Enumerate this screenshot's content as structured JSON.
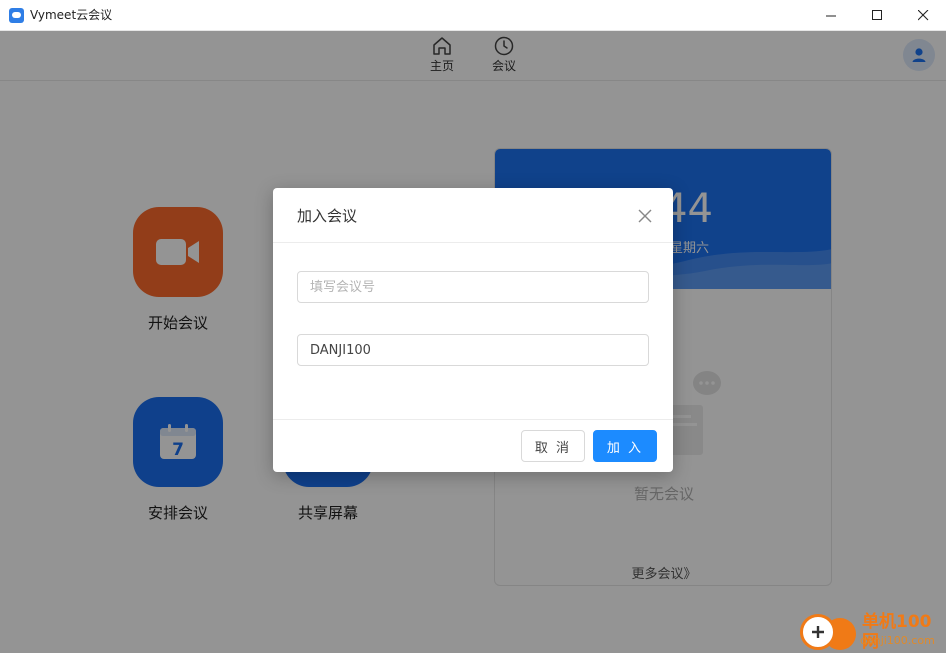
{
  "window": {
    "title": "Vymeet云会议"
  },
  "nav": {
    "home_label": "主页",
    "meetings_label": "会议"
  },
  "actions": {
    "start_label": "开始会议",
    "schedule_label": "安排会议",
    "schedule_day": "7",
    "share_label": "共享屏幕"
  },
  "panel": {
    "time_partial": "44",
    "weekday_partial": "星期六",
    "empty_text": "暂无会议",
    "more_link": "更多会议》"
  },
  "dialog": {
    "title": "加入会议",
    "meeting_id_placeholder": "填写会议号",
    "meeting_id_value": "",
    "display_name_value": "DANJI100",
    "cancel_label": "取 消",
    "join_label": "加 入"
  },
  "watermark": {
    "cn": "单机100网",
    "en": "danji100.com"
  },
  "colors": {
    "accent_blue": "#1c72f0",
    "start_orange": "#fb6a2c",
    "primary_button": "#1c8bff"
  }
}
